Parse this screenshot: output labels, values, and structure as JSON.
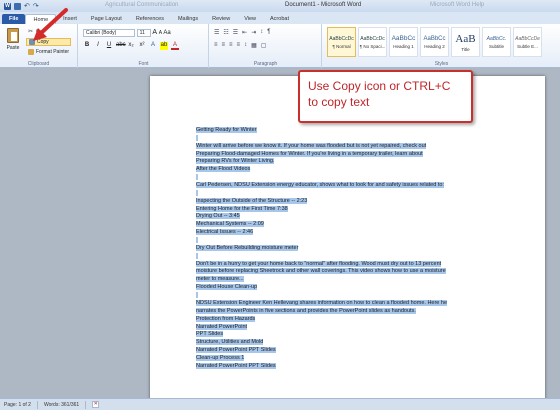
{
  "window": {
    "title": "Document1 - Microsoft Word",
    "ghost_text_left": "Agricultural Communication",
    "ghost_text_right": "Microsoft Word Help"
  },
  "quick_access": {
    "undo": "↶",
    "redo": "↷"
  },
  "tabs": [
    "File",
    "Home",
    "Insert",
    "Page Layout",
    "References",
    "Mailings",
    "Review",
    "View",
    "Acrobat"
  ],
  "ribbon": {
    "clipboard": {
      "paste": "Paste",
      "cut": "Cut",
      "copy": "Copy",
      "format_painter": "Format Painter",
      "label": "Clipboard"
    },
    "font": {
      "name": "Calibri (Body)",
      "size": "11",
      "grow": "A",
      "shrink": "A",
      "case": "Aa",
      "bold": "B",
      "italic": "I",
      "underline": "U",
      "strike": "abc",
      "sub": "x₂",
      "sup": "x²",
      "effects": "A",
      "highlight": "ab",
      "color": "A",
      "label": "Font"
    },
    "paragraph": {
      "label": "Paragraph",
      "row1": [
        "☰",
        "☷",
        "☰",
        "⇤",
        "⇥",
        "↕",
        "¶"
      ],
      "row2": [
        "≡",
        "≡",
        "≡",
        "≡",
        "↕",
        "▦",
        "▢"
      ]
    },
    "styles": {
      "label": "Styles",
      "tiles": [
        {
          "preview": "AaBbCcDc",
          "name": "¶ Normal"
        },
        {
          "preview": "AaBbCcDc",
          "name": "¶ No Spaci..."
        },
        {
          "preview": "AaBbCc",
          "name": "Heading 1"
        },
        {
          "preview": "AaBbCc",
          "name": "Heading 2"
        },
        {
          "preview": "AaB",
          "name": "Title"
        },
        {
          "preview": "AaBbCc.",
          "name": "Subtitle"
        },
        {
          "preview": "AaBbCcDe",
          "name": "Subtle E..."
        }
      ]
    }
  },
  "document": {
    "lines": [
      "Getting Ready for Winter",
      "",
      "Winter will arrive before we know it. If your home was flooded but is not yet repaired, check out",
      "Preparing Flood-damaged Homes for Winter. If you're living in a temporary trailer, learn about",
      "Preparing RVs for Winter Living.",
      "After the Flood Videos",
      "",
      "Carl Pedersen, NDSU Extension energy educator, shows what to look for and safety issues related to:",
      "",
      "   Inspecting the Outside of the Structure -- 2:23",
      "   Entering Home for the First Time     7:38",
      "   Drying Out -- 3:45",
      "   Mechanical Systems -- 2:09",
      "   Electrical Issues -- 2:46",
      "",
      "Dry Out Before Rebuilding moisture meter",
      "",
      "Don't be in a hurry to get your home back to \"normal\" after flooding. Wood must dry out to 13 percent",
      "moisture before replacing Sheetrock and other wall coverings. This video shows how to use a moisture",
      "meter to measure...",
      "Flooded House Clean-up",
      "",
      "NDSU Extension Engineer Ken Hellevang shares information on how to clean a flooded home. Here he",
      "narrates the PowerPoints in five sections and provides the PowerPoint slides as handouts.",
      "Protection from Hazards",
      "          Narrated PowerPoint",
      "          PPT Slides",
      "Structure, Utilities and Mold",
      "          Narrated PowerPoint      PPT Slides",
      "Clean-up Process 1",
      "          Narrated PowerPoint      PPT Slides"
    ]
  },
  "callout": {
    "line1": "Use Copy icon or CTRL+C",
    "line2": "to copy text"
  },
  "status": {
    "page": "Page: 1 of 2",
    "words": "Words: 361/361"
  }
}
